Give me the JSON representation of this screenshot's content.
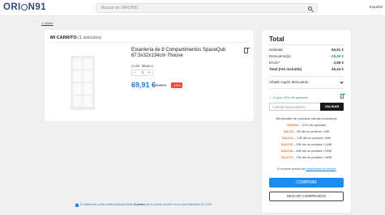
{
  "header": {
    "logo_text": "ORI",
    "logo_tail": "N91",
    "search_placeholder": "Buscar en ORION91",
    "language": "Español"
  },
  "nav": {
    "back_label": "< Volver"
  },
  "cart": {
    "title": "MI CARRITO",
    "count_label": "(1 artículos)",
    "item": {
      "title": "Estantería de 8 Compartimentos SpaceQub 67,5x32x134cm 7house",
      "color": "Color: Blanco",
      "quantity": "1",
      "qty_minus": "−",
      "qty_plus": "+",
      "price": "69,91 €",
      "old_price": "79,90 €",
      "discount": "-13%",
      "image": "white-bookshelf-8-cubes"
    }
  },
  "summary": {
    "title": "Total",
    "rows": [
      {
        "label": "Subtotal",
        "value": "69,91 €"
      },
      {
        "label": "Descuento(s)",
        "value": "- 28,46 €"
      },
      {
        "label": "Envío*",
        "value": "3,99 €"
      },
      {
        "label": "Total (IVA incluido)",
        "value": "45,44 €"
      }
    ],
    "coupon_toggle": "Añadir cupón descuento",
    "applied_coupon": "✓ Cupón 31% dto aplicado",
    "coupon_placeholder": "CUPÓN DESCUENTO",
    "coupon_button": "VALIDAR",
    "benefits_title": "Benefíciate de nuestras ofertas exclusivas",
    "codes": [
      {
        "code": "ORION1",
        "text": " – 31% dto aplicado"
      },
      {
        "code": "SALE5",
        "text": " – 5€ dto en pedidos +49€"
      },
      {
        "code": "SALE12",
        "text": " – 12€ dto en pedidos +89€"
      },
      {
        "code": "SALE25",
        "text": " – 25€ dto en pedidos +149€"
      },
      {
        "code": "SALE45",
        "text": " – 45€ dto en pedidos +299€"
      },
      {
        "code": "SALE70",
        "text": " – 70€ dto en pedidos +499€"
      }
    ],
    "terms_prefix": "Al comprar acepto las ",
    "terms_link": "condiciones de compra",
    "buy_button": "COMPRAR",
    "continue_button": "SEGUIR COMPRANDO"
  },
  "notice": {
    "info_icon": "i",
    "prefix": "Si validas este carrito puedes acumular hasta ",
    "highlight": "13 puntos",
    "suffix": " que te podrán convertir en un cupón descuento de 1,30 €"
  },
  "colors": {
    "brand": "#2f4b7c",
    "accent": "#1d8cf0",
    "discount": "#e84c3d",
    "success": "#2e9b4f",
    "coupon_code": "#e8772e"
  }
}
